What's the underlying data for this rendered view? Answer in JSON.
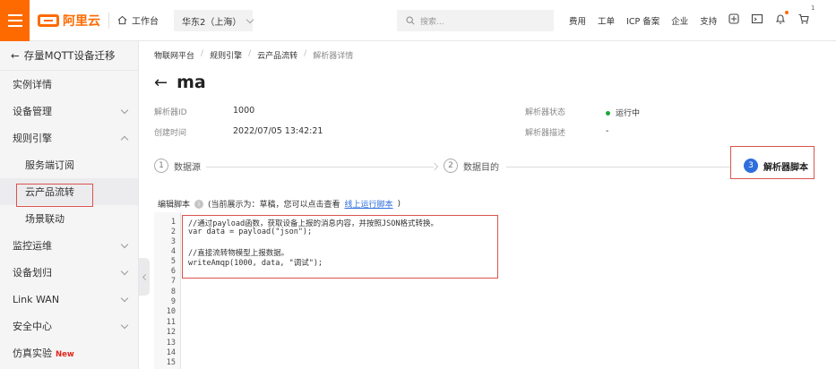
{
  "header": {
    "logo_text": "阿里云",
    "workbench": "工作台",
    "region": "华东2（上海）",
    "search_placeholder": "搜索...",
    "nav": [
      "费用",
      "工单",
      "ICP 备案",
      "企业",
      "支持"
    ],
    "cart_count": "1"
  },
  "sidebar": {
    "back_title": "存量MQTT设备迁移",
    "items": [
      {
        "label": "实例详情",
        "expandable": false
      },
      {
        "label": "设备管理",
        "expandable": true
      },
      {
        "label": "规则引擎",
        "expandable": true,
        "expanded": true
      },
      {
        "label": "服务端订阅",
        "sub": true
      },
      {
        "label": "云产品流转",
        "sub": true,
        "active": true
      },
      {
        "label": "场景联动",
        "sub": true
      },
      {
        "label": "监控运维",
        "expandable": true
      },
      {
        "label": "设备划归",
        "expandable": true
      },
      {
        "label": "Link WAN",
        "expandable": true
      },
      {
        "label": "安全中心",
        "expandable": true
      },
      {
        "label": "仿真实验",
        "tag": "New"
      }
    ]
  },
  "breadcrumb": [
    "物联网平台",
    "规则引擎",
    "云产品流转",
    "解析器详情"
  ],
  "page_title": "ma",
  "details": {
    "id_label": "解析器ID",
    "id_value": "1000",
    "created_label": "创建时间",
    "created_value": "2022/07/05 13:42:21",
    "status_label": "解析器状态",
    "status_value": "运行中",
    "desc_label": "解析器描述",
    "desc_value": "-"
  },
  "steps": [
    {
      "num": "1",
      "label": "数据源"
    },
    {
      "num": "2",
      "label": "数据目的"
    },
    {
      "num": "3",
      "label": "解析器脚本",
      "active": true
    }
  ],
  "editor": {
    "label": "编辑脚本",
    "note": "(当前展示为：草稿，您可以点击查看",
    "link": "线上运行脚本",
    "note_end": ")",
    "line_numbers": [
      "1",
      "2",
      "3",
      "4",
      "5",
      "6",
      "7",
      "8",
      "9",
      "10",
      "11",
      "12",
      "13",
      "14",
      "15"
    ],
    "code": [
      "//通过payload函数，获取设备上报的消息内容，并按照JSON格式转换。",
      "var data = payload(\"json\");",
      "",
      "//直接流转物模型上报数据。",
      "writeAmqp(1000, data, \"调试\");"
    ]
  },
  "colors": {
    "accent": "#ff6a00",
    "primary": "#2f6fdd",
    "status_running": "#1fa63a",
    "annotation": "#d9534f"
  }
}
